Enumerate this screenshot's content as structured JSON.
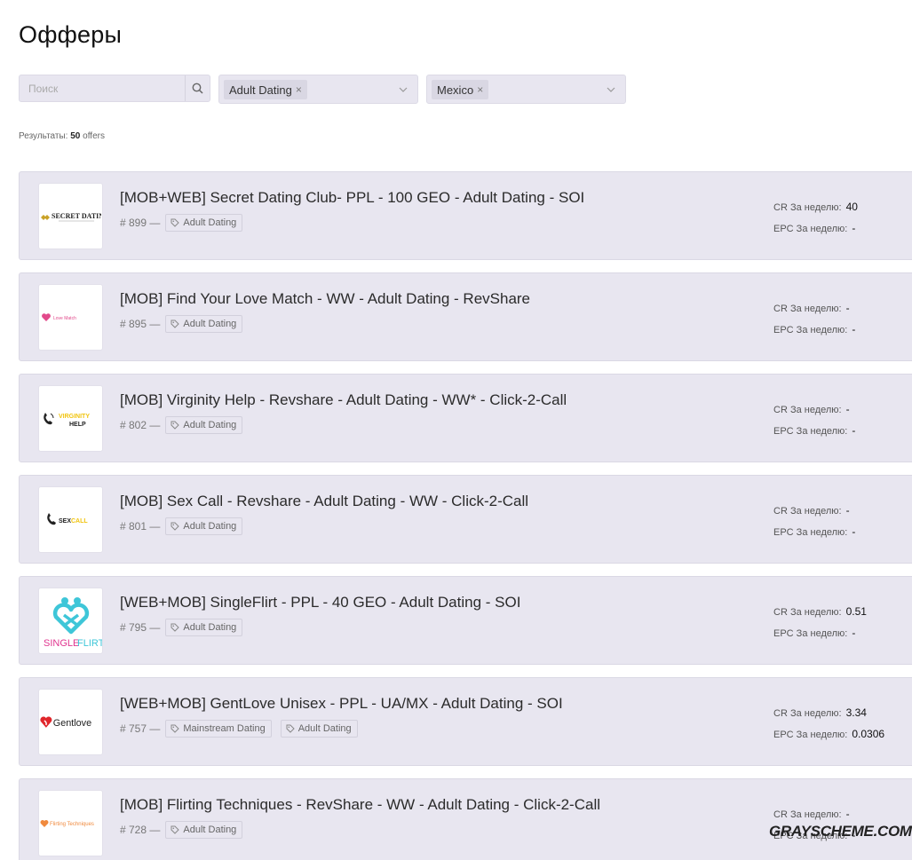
{
  "page": {
    "title": "Офферы"
  },
  "filters": {
    "search_placeholder": "Поиск",
    "category": {
      "selected": "Adult Dating",
      "remove": "×"
    },
    "country": {
      "selected": "Mexico",
      "remove": "×"
    }
  },
  "results": {
    "label": "Результаты:",
    "count": "50",
    "unit": "offers"
  },
  "stat_labels": {
    "cr": "CR За неделю:",
    "epc": "EPC За неделю:"
  },
  "offers": [
    {
      "title": "[MOB+WEB] Secret Dating Club- PPL - 100 GEO - Adult Dating - SOI",
      "id": "# 899 —",
      "tags": [
        "Adult Dating"
      ],
      "cr": "40",
      "epc": "-",
      "logo": {
        "text": "SECRET DATING",
        "icon": "secret-dating-logo"
      }
    },
    {
      "title": "[MOB] Find Your Love Match - WW - Adult Dating - RevShare",
      "id": "# 895 —",
      "tags": [
        "Adult Dating"
      ],
      "cr": "-",
      "epc": "-",
      "logo": {
        "text": "Love Match",
        "icon": "love-match-logo"
      }
    },
    {
      "title": "[MOB] Virginity Help - Revshare - Adult Dating - WW* - Click-2-Call",
      "id": "# 802 —",
      "tags": [
        "Adult Dating"
      ],
      "cr": "-",
      "epc": "-",
      "logo": {
        "text_top": "VIRGINITY",
        "text_bottom": "HELP",
        "icon": "virginity-help-logo"
      }
    },
    {
      "title": "[MOB] Sex Call - Revshare - Adult Dating - WW - Click-2-Call",
      "id": "# 801 —",
      "tags": [
        "Adult Dating"
      ],
      "cr": "-",
      "epc": "-",
      "logo": {
        "text_a": "SEX",
        "text_b": "CALL",
        "icon": "sex-call-logo"
      }
    },
    {
      "title": "[WEB+MOB] SingleFlirt - PPL - 40 GEO - Adult Dating - SOI",
      "id": "# 795 —",
      "tags": [
        "Adult Dating"
      ],
      "cr": "0.51",
      "epc": "-",
      "logo": {
        "text_a": "SINGLE",
        "text_b": "FLIRT",
        "icon": "single-flirt-logo"
      }
    },
    {
      "title": "[WEB+MOB] GentLove Unisex - PPL - UA/MX - Adult Dating - SOI",
      "id": "# 757 —",
      "tags": [
        "Mainstream Dating",
        "Adult Dating"
      ],
      "cr": "3.34",
      "epc": "0.0306",
      "logo": {
        "text": "Gentlove",
        "icon": "gentlove-logo"
      }
    },
    {
      "title": "[MOB] Flirting Techniques - RevShare - WW - Adult Dating - Click-2-Call",
      "id": "# 728 —",
      "tags": [
        "Adult Dating"
      ],
      "cr": "-",
      "epc": "-",
      "logo": {
        "text": "Flirting Techniques",
        "icon": "flirting-techniques-logo"
      }
    }
  ],
  "watermark": "GRAYSCHEME.COM",
  "colors": {
    "card_bg": "#e8e6f0",
    "tag_border": "#d2d0dc",
    "singleflirt_teal": "#3ec6d8",
    "singleflirt_pink": "#e0358f",
    "gentlove_red": "#e0262b",
    "virginity_yellow": "#f1c40f"
  }
}
